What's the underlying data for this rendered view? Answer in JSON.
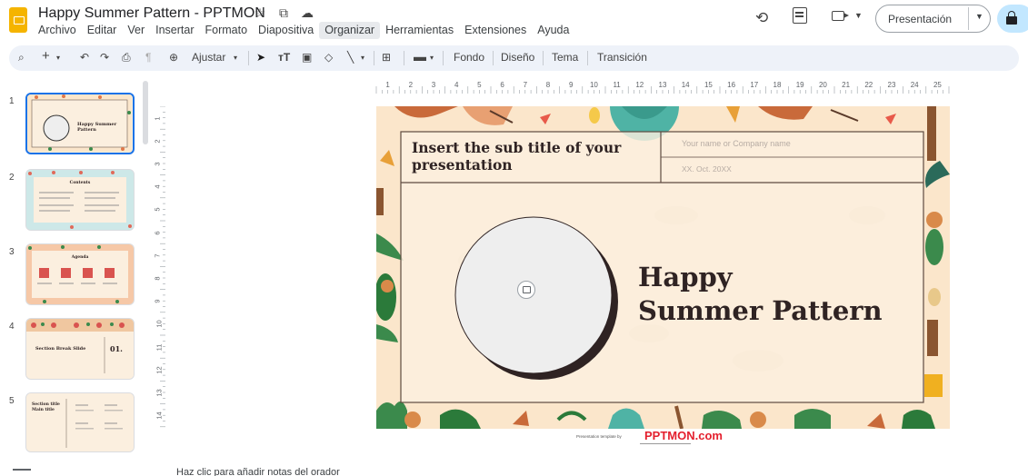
{
  "document": {
    "title": "Happy Summer Pattern - PPTMON"
  },
  "menu": [
    "Archivo",
    "Editar",
    "Ver",
    "Insertar",
    "Formato",
    "Diapositiva",
    "Organizar",
    "Herramientas",
    "Extensiones",
    "Ayuda"
  ],
  "menu_active": "Organizar",
  "header": {
    "present_label": "Presentación"
  },
  "toolbar": {
    "zoom_label": "Ajustar",
    "fondo": "Fondo",
    "diseno": "Diseño",
    "tema": "Tema",
    "transicion": "Transición"
  },
  "ruler": {
    "horizontal": [
      "1",
      "2",
      "3",
      "4",
      "5",
      "6",
      "7",
      "8",
      "9",
      "10",
      "11",
      "12",
      "13",
      "14",
      "15",
      "16",
      "17",
      "18",
      "19",
      "20",
      "21",
      "22",
      "23",
      "24",
      "25"
    ],
    "vertical": [
      "1",
      "2",
      "3",
      "4",
      "5",
      "6",
      "7",
      "8",
      "9",
      "10",
      "11",
      "12",
      "13",
      "14"
    ]
  },
  "slides": [
    {
      "number": "1",
      "title": "Happy Summer Pattern",
      "selected": true
    },
    {
      "number": "2",
      "title": "Contents"
    },
    {
      "number": "3",
      "title": "Agenda"
    },
    {
      "number": "4",
      "title": "Section Break Slide",
      "badge": "01."
    },
    {
      "number": "5",
      "title": "Section title Main title"
    }
  ],
  "slide": {
    "subtitle": "Insert the sub title of your presentation",
    "company": "Your name or Company name",
    "date": "XX. Oct. 20XX",
    "title_line1": "Happy",
    "title_line2": "Summer Pattern"
  },
  "footer": {
    "caption": "Presentation template by",
    "brand": "PPTMON.com"
  },
  "notes": {
    "placeholder": "Haz clic para añadir notas del orador"
  },
  "colors": {
    "accent_blue": "#1a73e8",
    "slide_bg": "#fbe6cb",
    "title_dark": "#2f2323",
    "brand_red": "#e4202e",
    "present_lock_bg": "#c2e7ff"
  }
}
